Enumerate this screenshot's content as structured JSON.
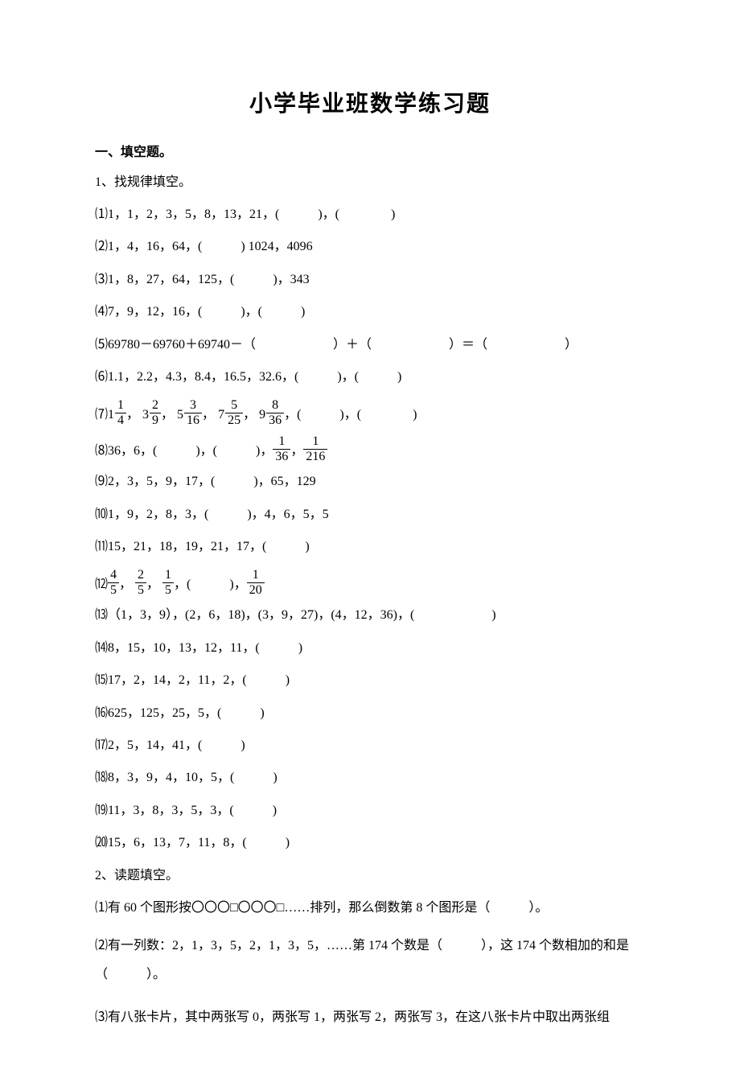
{
  "title": "小学毕业班数学练习题",
  "sectionA": "一、填空题。",
  "q1": {
    "stem": "1、找规律填空。",
    "items": {
      "i1": "⑴1，1，2，3，5，8，13，21，(　　　)，(　　　　)",
      "i2": "⑵1，4，16，64，(　　　) 1024，4096",
      "i3": "⑶1，8，27，64，125，(　　　)，343",
      "i4": "⑷7，9，12，16，(　　　)，(　　　)",
      "i5": "⑸69780－69760＋69740－（　　　　　　）＋（　　　　　　）＝（　　　　　　）",
      "i6": "⑹1.1，2.2，4.3，8.4，16.5，32.6，(　　　)，(　　　)",
      "i7": {
        "prefix": "⑺",
        "m1": {
          "w": "1",
          "n": "1",
          "d": "4"
        },
        "m2": {
          "w": "3",
          "n": "2",
          "d": "9"
        },
        "m3": {
          "w": "5",
          "n": "3",
          "d": "16"
        },
        "m4": {
          "w": "7",
          "n": "5",
          "d": "25"
        },
        "m5": {
          "w": "9",
          "n": "8",
          "d": "36"
        },
        "tail": "，(　　　)，(　　　　)"
      },
      "i8": {
        "prefix": "⑻36，6，(　　　)，(　　　)，",
        "f1": {
          "n": "1",
          "d": "36"
        },
        "sep": "，",
        "f2": {
          "n": "1",
          "d": "216"
        }
      },
      "i9": "⑼2，3，5，9，17，(　　　)，65，129",
      "i10": "⑽1，9，2，8，3，(　　　)，4，6，5，5",
      "i11": "⑾15，21，18，19，21，17，(　　　)",
      "i12": {
        "prefix": "⑿",
        "f1": {
          "n": "4",
          "d": "5"
        },
        "f2": {
          "n": "2",
          "d": "5"
        },
        "f3": {
          "n": "1",
          "d": "5"
        },
        "mid": "，(　　　)，",
        "f4": {
          "n": "1",
          "d": "20"
        }
      },
      "i13": "⒀（1，3，9），(2，6，18)，(3，9，27)，(4，12，36)，(　　　　　　)",
      "i14": "⒁8，15，10，13，12，11，(　　　)",
      "i15": "⒂17，2，14，2，11，2，(　　　)",
      "i16": "⒃625，125，25，5，(　　　)",
      "i17": "⒄2，5，14，41，(　　　)",
      "i18": "⒅8，3，9，4，10，5，(　　　)",
      "i19": "⒆11，3，8，3，5，3，(　　　)",
      "i20": "⒇15，6，13，7，11，8，(　　　)"
    }
  },
  "q2": {
    "stem": "2、读题填空。",
    "items": {
      "i1": "⑴有 60 个图形按〇〇〇□〇〇〇□……排列，那么倒数第 8 个图形是（　　　）。",
      "i2": "⑵有一列数：2，1，3，5，2，1，3，5，……第 174 个数是（　　　），这 174 个数相加的和是（　　　）。",
      "i3": "⑶有八张卡片，其中两张写 0，两张写 1，两张写 2，两张写 3，在这八张卡片中取出两张组"
    }
  }
}
